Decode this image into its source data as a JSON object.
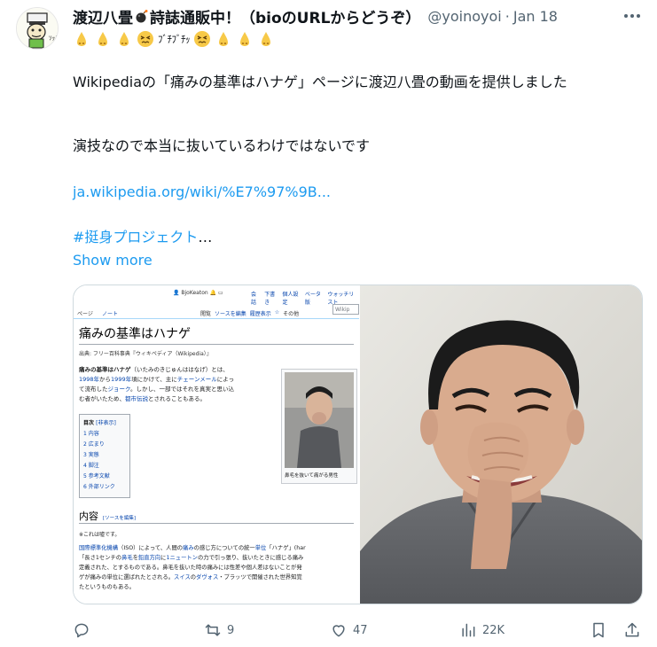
{
  "tweet": {
    "display_name": "渡辺八畳",
    "display_name_suffix": "詩誌通販中！（bioのURLからどうぞ）",
    "handle": "@yoinoyoi",
    "date": "Jan 18",
    "emoji_text": "ﾌﾞﾁﾌﾞﾁｯ",
    "text_line1": "Wikipediaの「痛みの基準はハナゲ」ページに渡辺八畳の動画を提供しました",
    "text_line2": "演技なので本当に抜いているわけではないです",
    "link_url": "ja.wikipedia.org/wiki/%E7%97%9B...",
    "hashtag": "#挺身プロジェクト",
    "ellipsis": "…",
    "show_more": "Show more"
  },
  "wiki_screenshot": {
    "user": "BjoKeaton",
    "top_links": [
      "会話",
      "下書き",
      "個人設定",
      "ベータ版",
      "ウォッチリスト"
    ],
    "tab_page": "ページ",
    "tab_talk": "ノート",
    "tab_read": "閲覧",
    "tab_edit_source": "ソースを編集",
    "tab_history": "履歴表示",
    "tab_other": "その他",
    "search_placeholder": "Wikip",
    "title": "痛みの基準はハナゲ",
    "from": "出典: フリー百科事典『ウィキペディア（Wikipedia）』",
    "lead_bold": "痛みの基準はハナゲ",
    "lead_1": "（いたみのきじゅんははなげ）とは、",
    "lead_2a": "1998年",
    "lead_2b": "から",
    "lead_2c": "1999年",
    "lead_2d": "頃にかけて、主に",
    "lead_2e": "チェーンメール",
    "lead_2f": "によっ",
    "lead_3a": "て流布した",
    "lead_3b": "ジョーク",
    "lead_3c": "。しかし、一部ではそれを真実と思い込",
    "lead_4a": "む者がいたため、",
    "lead_4b": "都市伝説",
    "lead_4c": "とされることもある。",
    "thumb_caption": "鼻毛を抜いて痛がる男性",
    "toc_title": "目次",
    "toc_toggle": "[非表示]",
    "toc_items": [
      "1 内容",
      "2 広まり",
      "3 実態",
      "4 脚注",
      "5 参考文献",
      "6 外部リンク"
    ],
    "h2": "内容",
    "h2_edit": "[ソースを編集]",
    "note": "※これは嘘です。",
    "body_1a": "国際標準化機構",
    "body_1b": "（ISO）によって、人間の",
    "body_1c": "痛み",
    "body_1d": "の感じ方についての統一",
    "body_1e": "単位",
    "body_1f": "「ハナゲ」(har",
    "body_2a": "「長さ1センチの",
    "body_2b": "鼻毛",
    "body_2c": "を",
    "body_2d": "鉛直方向",
    "body_2e": "に",
    "body_2f": "1ニュートン",
    "body_2g": "の力で引っ張り、抜いたときに感じる痛み",
    "body_3": "定義された、とするものである。鼻毛を抜いた時の痛みには性差や個人差はないことが発",
    "body_4a": "ゲが痛みの単位に選ばれたとされる。",
    "body_4b": "スイス",
    "body_4c": "の",
    "body_4d": "ダヴォス",
    "body_4e": "・プラッツで開催された世界知覚",
    "body_5": "たというものもある。"
  },
  "actions": {
    "reply_count": "",
    "retweet_count": "9",
    "like_count": "47",
    "view_count": "22K"
  },
  "colors": {
    "accent": "#1d9bf0",
    "muted": "#536471",
    "text": "#0f1419",
    "wiki_link": "#0645ad"
  }
}
